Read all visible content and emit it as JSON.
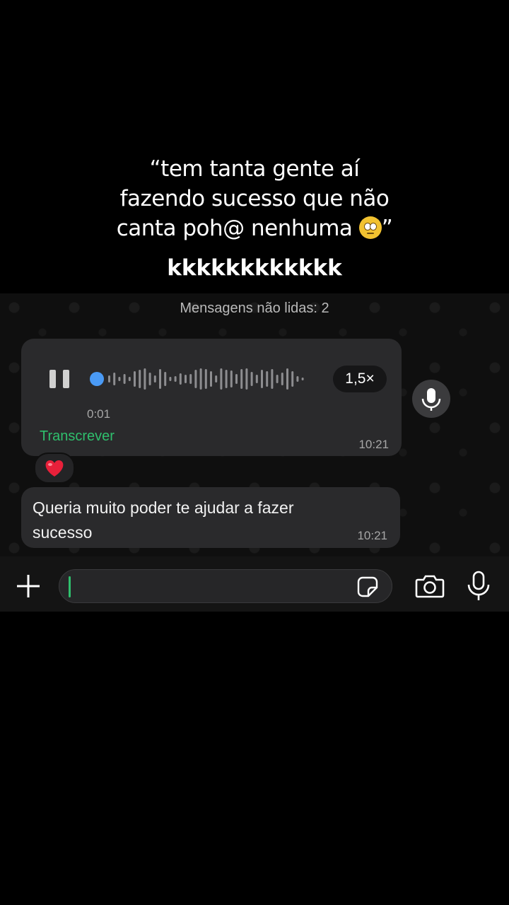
{
  "caption": {
    "line1": "“tem tanta gente aí",
    "line2": "fazendo sucesso que não",
    "line3": "canta poh@ nenhuma",
    "line3_end": "”",
    "emoji_icon": "face-with-rolling-eyes-emoji",
    "laugh": "kkkkkkkkkkkk"
  },
  "chat": {
    "unread_label": "Mensagens não lidas: 2",
    "voice_message": {
      "duration": "0:01",
      "speed": "1,5×",
      "transcribe_label": "Transcrever",
      "time": "10:21",
      "progress": 0.0,
      "accent": "#4a9af5"
    },
    "reaction": "❤️",
    "text_message": {
      "text": "Queria muito poder te ajudar a fazer sucesso",
      "time": "10:21"
    }
  },
  "input_bar": {
    "message_value": "",
    "icons": [
      "plus-icon",
      "sticker-icon",
      "camera-icon",
      "microphone-icon"
    ],
    "cursor_color": "#2fbf6d"
  }
}
